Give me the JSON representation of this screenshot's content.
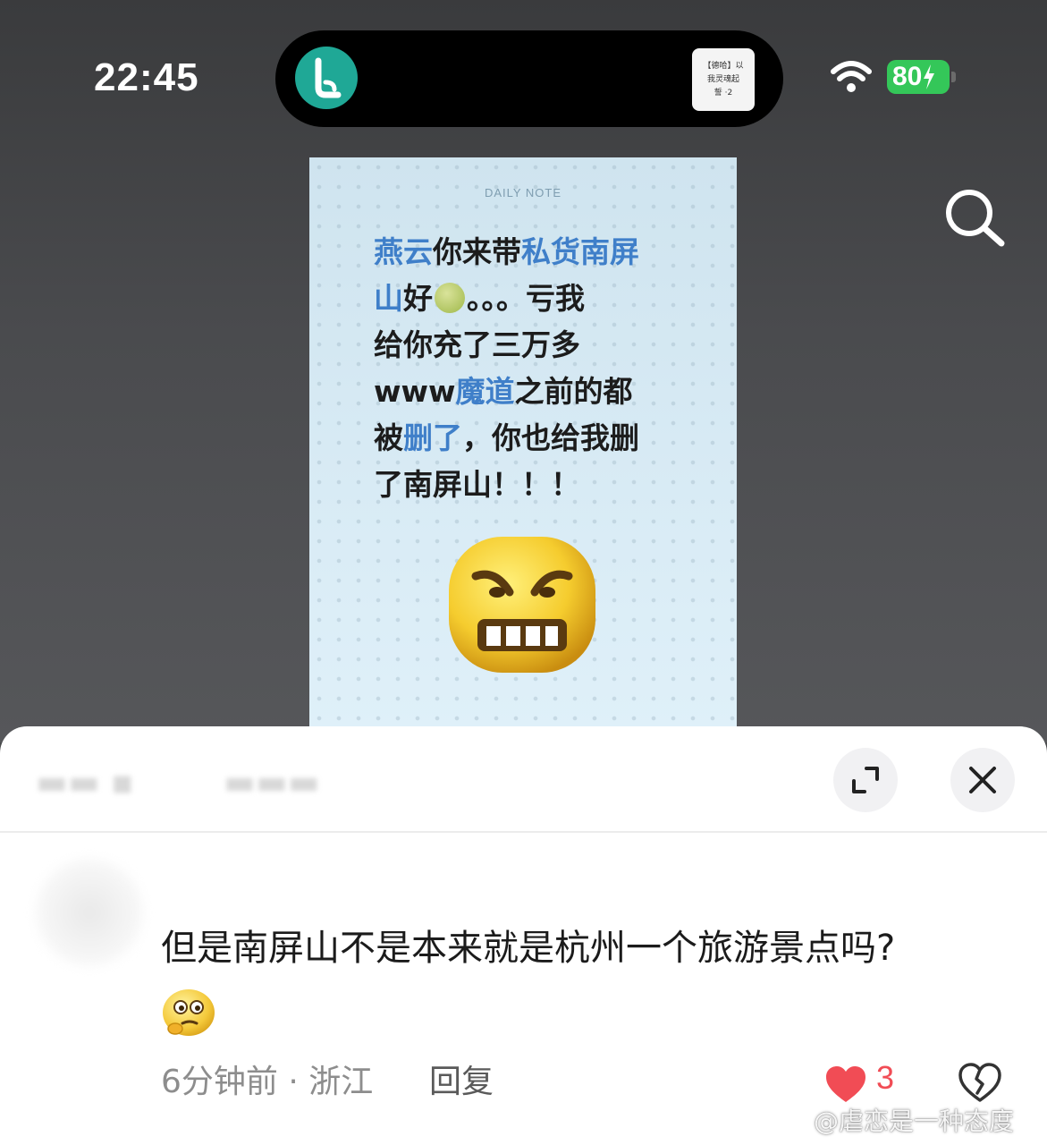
{
  "status_bar": {
    "time": "22:45",
    "battery": "80",
    "island_thumb_lines": [
      "【德哈】以",
      "我灵魂起",
      "誓 ·2"
    ]
  },
  "note": {
    "header": "DAILY NOTE",
    "lines": [
      [
        {
          "t": "燕云",
          "hl": true
        },
        {
          "t": "你来带",
          "hl": false
        },
        {
          "t": "私货南屏",
          "hl": true
        }
      ],
      [
        {
          "t": "山",
          "hl": true
        },
        {
          "t": "好",
          "hl": false
        }
      ],
      [
        {
          "t": "给你充了三万多",
          "hl": false
        }
      ],
      [
        {
          "t": "www",
          "hl": false
        },
        {
          "t": "魔道",
          "hl": true
        },
        {
          "t": "之前的都",
          "hl": false
        }
      ],
      [
        {
          "t": "被",
          "hl": false
        },
        {
          "t": "删了",
          "hl": true
        },
        {
          "t": "，你也给我删",
          "hl": false
        }
      ],
      [
        {
          "t": "了南屏山！！！",
          "hl": false
        }
      ]
    ],
    "line2_tail": "。。。亏我"
  },
  "comments": {
    "text": "但是南屏山不是本来就是杭州一个旅游景点吗?",
    "meta": "6分钟前 · 浙江",
    "reply_label": "回复",
    "like_count": "3"
  },
  "watermark": "@虐恋是一种态度",
  "colors": {
    "highlight": "#3f7fc9",
    "like": "#f14c55",
    "battery": "#34c759",
    "app_icon": "#1fa896"
  }
}
